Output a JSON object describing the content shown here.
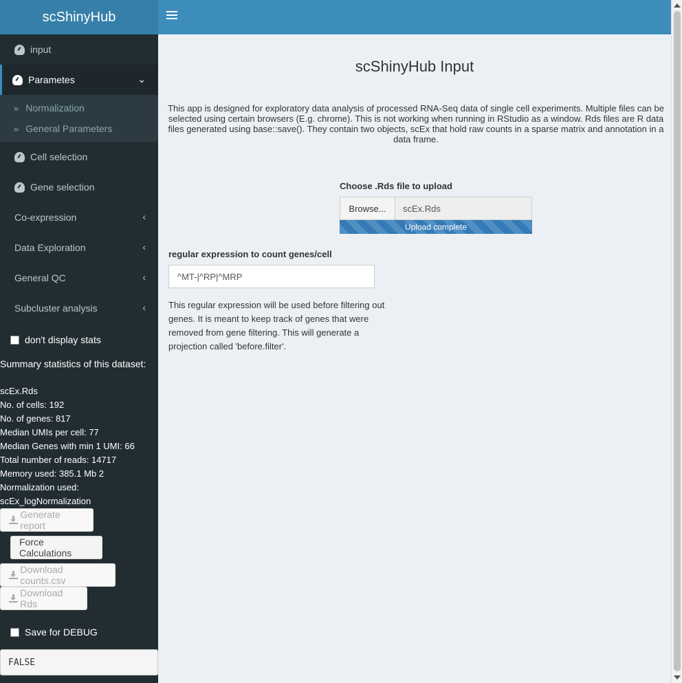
{
  "app_title": "scShinyHub",
  "sidebar": {
    "items": [
      {
        "label": "input",
        "icon": "dashboard-icon"
      },
      {
        "label": "Parametes",
        "icon": "dashboard-icon",
        "active": true
      },
      {
        "label": "Cell selection",
        "icon": "dashboard-icon"
      },
      {
        "label": "Gene selection",
        "icon": "dashboard-icon"
      },
      {
        "label": "Co-expression"
      },
      {
        "label": "Data Exploration"
      },
      {
        "label": "General QC"
      },
      {
        "label": "Subcluster analysis"
      }
    ],
    "submenu": [
      {
        "label": "Normalization"
      },
      {
        "label": "General Parameters"
      }
    ],
    "dont_display_stats_label": "don't display stats",
    "stats_title": "Summary statistics of this dataset:",
    "stats": [
      "scEx.Rds",
      "No. of cells: 192",
      "No. of genes: 817",
      "Median UMIs per cell: 77",
      "Median Genes with min 1 UMI: 66",
      "Total number of reads: 14717",
      "Memory used: 385.1 Mb 2",
      "Normalization used:",
      "scEx_logNormalization"
    ],
    "generate_report_label": "Generate report",
    "force_calc_label": "Force Calculations",
    "download_counts_label": "Download counts.csv",
    "download_rds_label": "Download Rds",
    "save_debug_label": "Save for DEBUG",
    "debug_output": "FALSE"
  },
  "main": {
    "title": "scShinyHub Input",
    "description": "This app is designed for exploratory data analysis of processed RNA-Seq data of single cell experiments. Multiple files can be selected using certain browsers (E.g. chrome). This is not working when running in RStudio as a window. Rds files are R data files generated using base::save(). They contain two objects, scEx that hold raw counts in a sparse matrix and annotation in a data frame.",
    "upload_label": "Choose .Rds file to upload",
    "browse_label": "Browse...",
    "file_name": "scEx.Rds",
    "upload_status": "Upload complete",
    "upload_progress": 1.0,
    "regex_label": "regular expression to count genes/cell",
    "regex_value": "^MT-|^RP|^MRP",
    "help_text": "This regular expression will be used before filtering out genes. It is meant to keep track of genes that were removed from gene filtering. This will generate a projection called 'before.filter'."
  },
  "colors": {
    "header": "#3c8dbc",
    "logo": "#367fa9",
    "sidebar": "#222d32",
    "progress": "#337ab7"
  }
}
